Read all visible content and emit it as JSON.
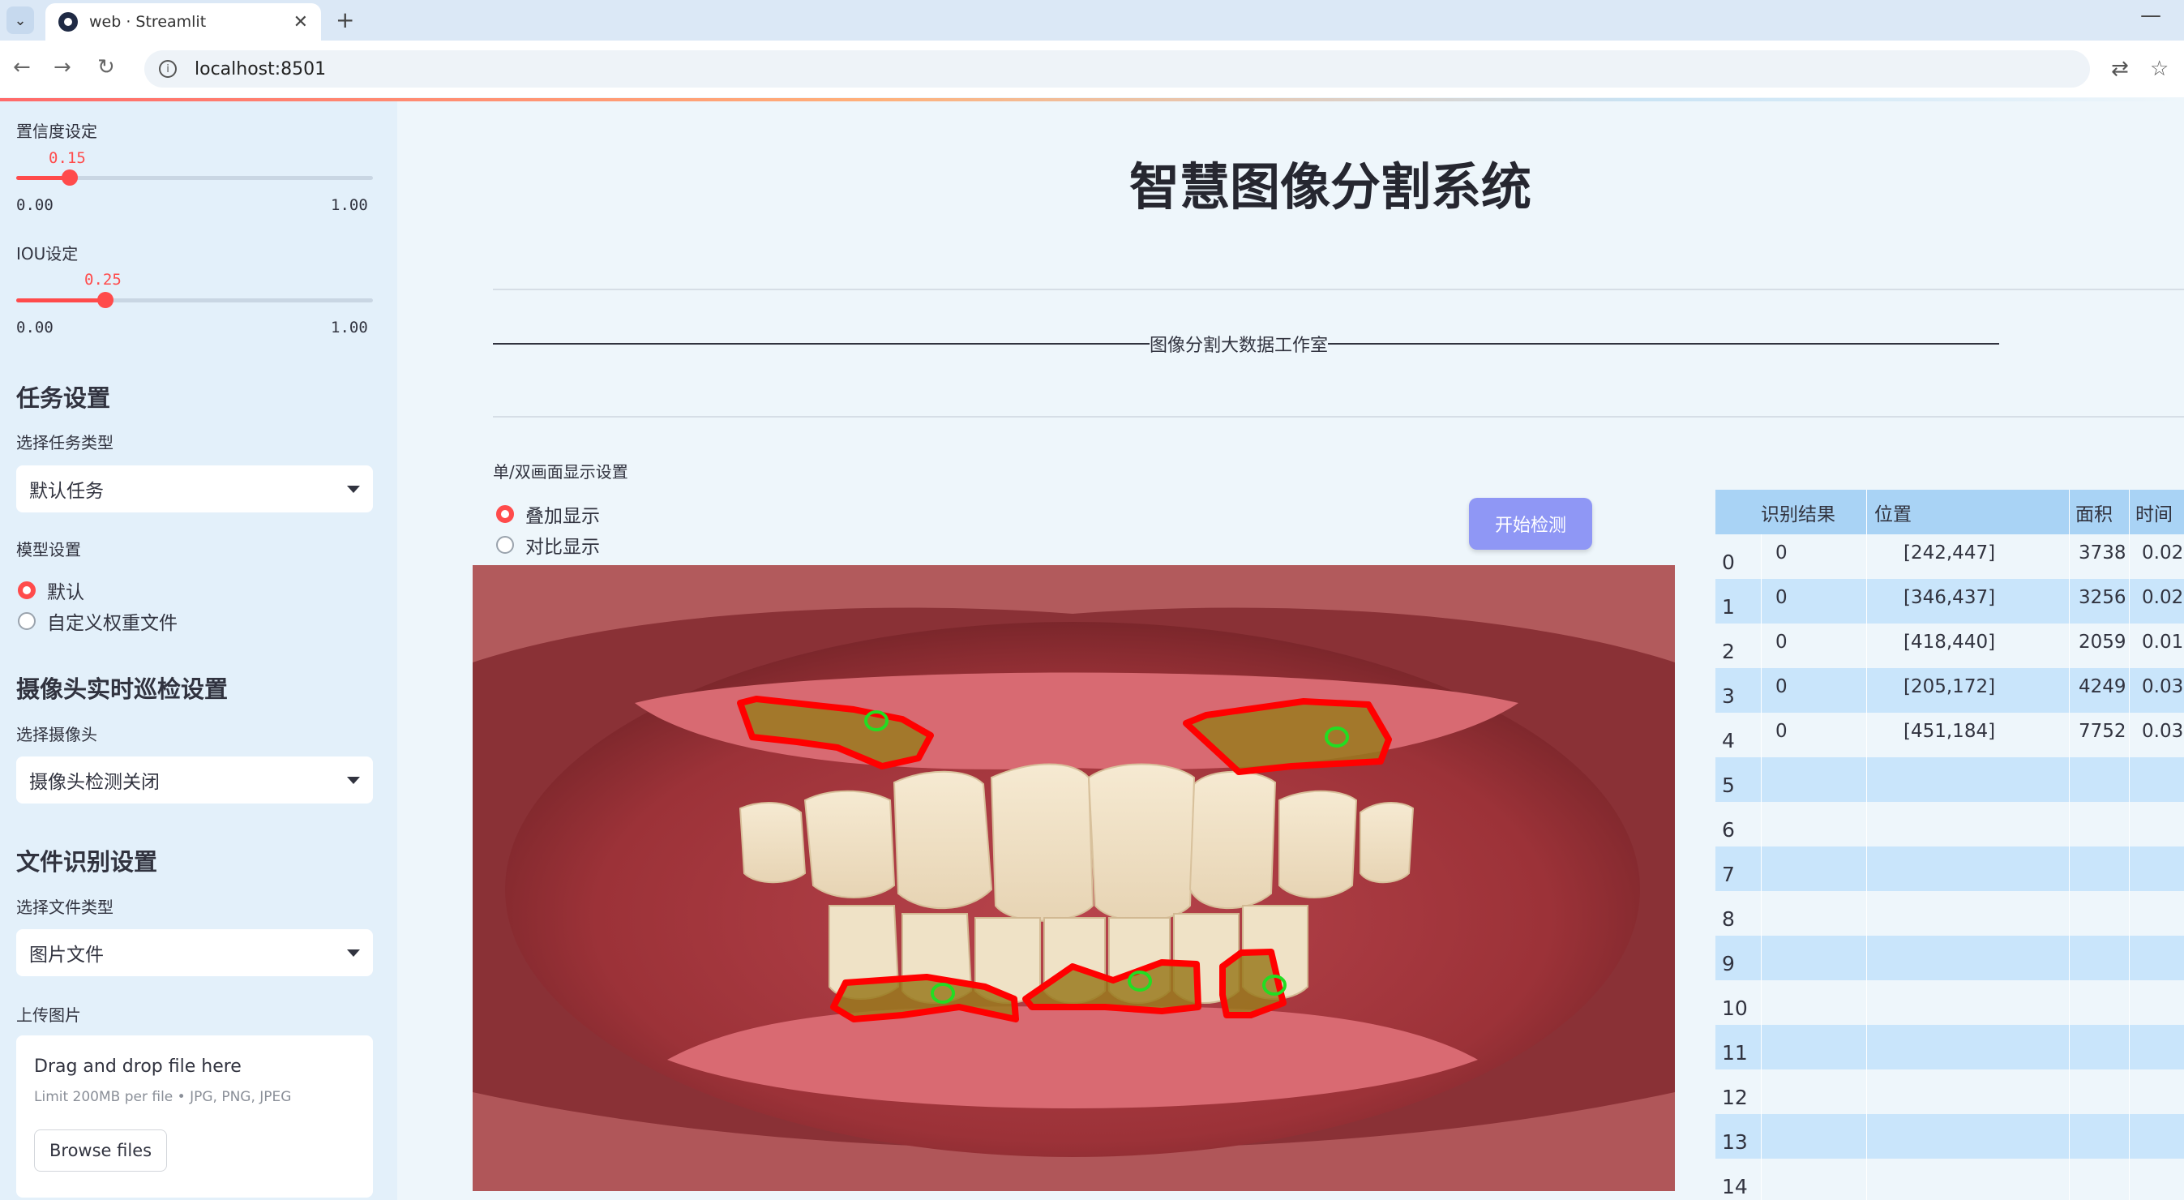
{
  "browser": {
    "tab_title": "web · Streamlit",
    "tab_close": "✕",
    "new_tab": "+",
    "url": "localhost:8501",
    "minimize": "—"
  },
  "sidebar": {
    "confidence": {
      "label": "置信度设定",
      "value": "0.15",
      "min": "0.00",
      "max": "1.00",
      "fraction": 0.15
    },
    "iou": {
      "label": "IOU设定",
      "value": "0.25",
      "min": "0.00",
      "max": "1.00",
      "fraction": 0.25
    },
    "task_header": "任务设置",
    "task_type_label": "选择任务类型",
    "task_type_value": "默认任务",
    "model_label": "模型设置",
    "model_options": [
      "默认",
      "自定义权重文件"
    ],
    "model_selected": 0,
    "camera_header": "摄像头实时巡检设置",
    "camera_label": "选择摄像头",
    "camera_value": "摄像头检测关闭",
    "file_header": "文件识别设置",
    "file_type_label": "选择文件类型",
    "file_type_value": "图片文件",
    "upload_label": "上传图片",
    "upload_drag": "Drag and drop file here",
    "upload_limit": "Limit 200MB per file • JPG, PNG, JPEG",
    "browse_button": "Browse files"
  },
  "main": {
    "title": "智慧图像分割系统",
    "studio_text": "图像分割大数据工作室",
    "display_label": "单/双画面显示设置",
    "display_options": [
      "叠加显示",
      "对比显示"
    ],
    "display_selected": 0,
    "start_button": "开始检测"
  },
  "table": {
    "headers": [
      "识别结果",
      "位置",
      "面积",
      "时间"
    ],
    "row_index": [
      "0",
      "1",
      "2",
      "3",
      "4",
      "5",
      "6",
      "7",
      "8",
      "9",
      "10",
      "11",
      "12",
      "13",
      "14"
    ],
    "rows": [
      [
        "0",
        "[242,447]",
        "3738",
        "0.02"
      ],
      [
        "0",
        "[346,437]",
        "3256",
        "0.02"
      ],
      [
        "0",
        "[418,440]",
        "2059",
        "0.01"
      ],
      [
        "0",
        "[205,172]",
        "4249",
        "0.03"
      ],
      [
        "0",
        "[451,184]",
        "7752",
        "0.03"
      ]
    ]
  },
  "colors": {
    "accent": "#ff4b4b",
    "button": "#8f97f5",
    "sidebar_bg": "#e3f0fa",
    "table_header": "#a9d3f5",
    "table_row_alt": "#c9e5fb",
    "mask_outline": "#ff0000",
    "mask_center": "#22dd22"
  }
}
